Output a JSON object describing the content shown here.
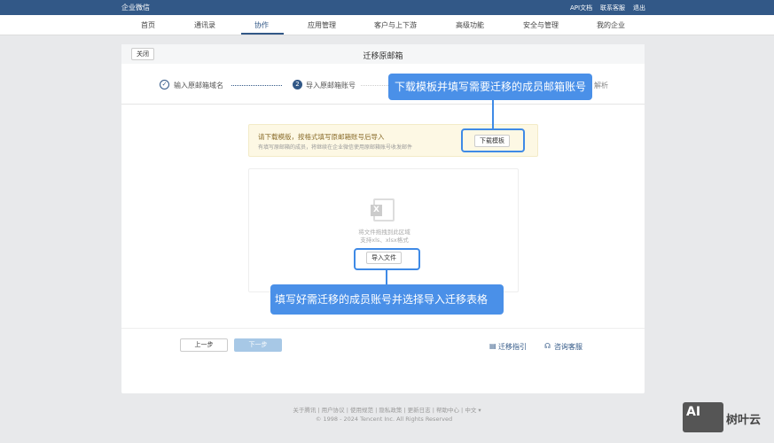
{
  "topbar": {
    "logo": "企业微信",
    "links": [
      "API文档",
      "联系客服",
      "退出"
    ]
  },
  "nav": [
    "首页",
    "通讯录",
    "协作",
    "应用管理",
    "客户与上下游",
    "高级功能",
    "安全与管理",
    "我的企业"
  ],
  "card": {
    "close": "关闭",
    "title": "迁移原邮箱"
  },
  "steps": [
    {
      "num": "✓",
      "label": "输入原邮箱域名"
    },
    {
      "num": "2",
      "label": "导入原邮箱账号"
    },
    {
      "label": "解析"
    }
  ],
  "notice": {
    "title": "请下载模版，按格式填写原邮箱账号后导入",
    "desc": "有填写原邮箱的成员，将继续在企业微信使用原邮箱账号收发邮件",
    "button": "下载模板"
  },
  "upload": {
    "line1": "将文件拖拽到此区域",
    "line2": "支持xls、xlsx格式",
    "button": "导入文件"
  },
  "actions": {
    "prev": "上一步",
    "next": "下一步",
    "guide": "迁移指引",
    "support": "咨询客服"
  },
  "footer": {
    "links": [
      "关于腾讯",
      "用户协议",
      "使用规范",
      "隐私政策",
      "更新日志",
      "帮助中心",
      "中文 ▾"
    ],
    "copyright": "© 1998 - 2024 Tencent Inc. All Rights Reserved"
  },
  "callouts": {
    "top": "下载模板并填写需要迁移的成员邮箱账号",
    "bottom": "填写好需迁移的成员账号并选择导入迁移表格"
  },
  "watermark": {
    "ai": "AI",
    "text": "树叶云"
  }
}
